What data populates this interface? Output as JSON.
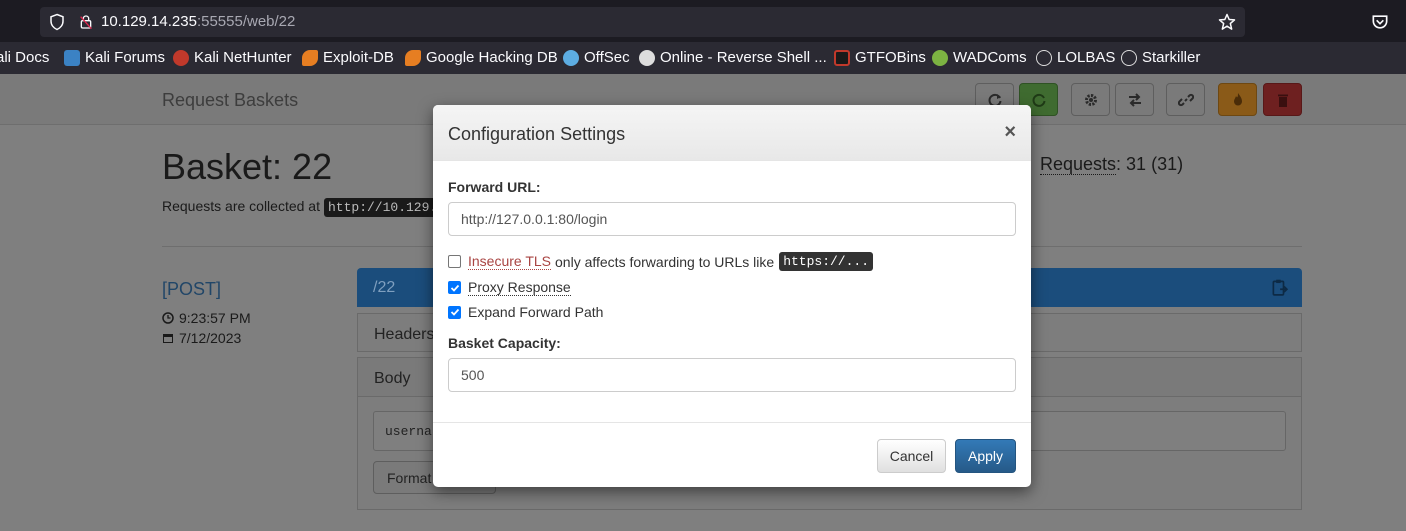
{
  "browser": {
    "url_host": "10.129.14.235",
    "url_rest": ":55555/web/22",
    "bookmarks": [
      {
        "label": "ali Docs",
        "icon": "kali-docs-icon",
        "color": "#4a90d9"
      },
      {
        "label": "Kali Forums",
        "icon": "kali-forums-icon",
        "color": "#3b82c4"
      },
      {
        "label": "Kali NetHunter",
        "icon": "kali-nethunter-icon",
        "color": "#c0392b"
      },
      {
        "label": "Exploit-DB",
        "icon": "exploit-db-icon",
        "color": "#e67e22"
      },
      {
        "label": "Google Hacking DB",
        "icon": "ghdb-icon",
        "color": "#e67e22"
      },
      {
        "label": "OffSec",
        "icon": "offsec-icon",
        "color": "#5dade2"
      },
      {
        "label": "Online - Reverse Shell ...",
        "icon": "skull-icon",
        "color": "#dddddd"
      },
      {
        "label": "GTFOBins",
        "icon": "gtfobins-icon",
        "color": "#c0392b"
      },
      {
        "label": "WADComs",
        "icon": "wadcoms-icon",
        "color": "#7cb342"
      },
      {
        "label": "LOLBAS",
        "icon": "globe-icon",
        "color": "#dddddd"
      },
      {
        "label": "Starkiller",
        "icon": "globe-icon",
        "color": "#dddddd"
      }
    ]
  },
  "app": {
    "brand": "Request Baskets",
    "basket_title": "Basket: 22",
    "collected_text": "Requests are collected at",
    "collected_url": "http://10.129.",
    "requests_label": "Requests",
    "requests_value": ": 31 (31)",
    "toolbar_colors": {
      "refresh_green": "#3f8a2e",
      "orange": "#d88a1c",
      "red": "#b02a2a"
    }
  },
  "request": {
    "method": "[POST]",
    "time": "9:23:57 PM",
    "date": "7/12/2023",
    "path": "/22",
    "headers_label": "Headers",
    "body_label": "Body",
    "body_preview": "usernar",
    "format_label": "Format"
  },
  "modal": {
    "title": "Configuration Settings",
    "close": "×",
    "forward_url_label": "Forward URL:",
    "forward_url_value": "http://127.0.0.1:80/login",
    "insecure_tls_label": "Insecure TLS",
    "insecure_tls_note": "only affects forwarding to URLs like",
    "insecure_tls_code": "https://...",
    "insecure_tls_checked": false,
    "proxy_response_label": "Proxy Response",
    "proxy_response_checked": true,
    "expand_path_label": "Expand Forward Path",
    "expand_path_checked": true,
    "capacity_label": "Basket Capacity:",
    "capacity_value": "500",
    "cancel_label": "Cancel",
    "apply_label": "Apply"
  }
}
